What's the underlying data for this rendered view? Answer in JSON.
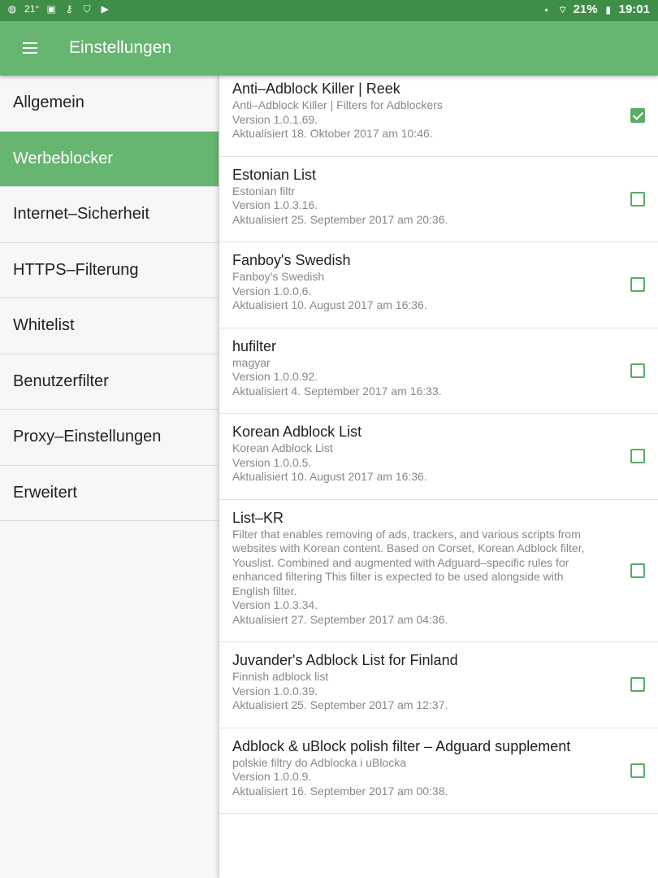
{
  "statusbar": {
    "temperature": "21°",
    "battery": "21%",
    "time": "19:01"
  },
  "appbar": {
    "title": "Einstellungen"
  },
  "sidebar": {
    "items": [
      {
        "label": "Allgemein",
        "active": false
      },
      {
        "label": "Werbeblocker",
        "active": true
      },
      {
        "label": "Internet–Sicherheit",
        "active": false
      },
      {
        "label": "HTTPS–Filterung",
        "active": false
      },
      {
        "label": "Whitelist",
        "active": false
      },
      {
        "label": "Benutzerfilter",
        "active": false
      },
      {
        "label": "Proxy–Einstellungen",
        "active": false
      },
      {
        "label": "Erweitert",
        "active": false
      }
    ]
  },
  "filters": [
    {
      "name": "Anti–Adblock Killer | Reek",
      "description": "Anti–Adblock Killer | Filters for Adblockers",
      "version": "Version 1.0.1.69.",
      "updated": "Aktualisiert 18. Oktober 2017 am 10:46.",
      "checked": true
    },
    {
      "name": "Estonian List",
      "description": "Estonian filtr",
      "version": "Version 1.0.3.16.",
      "updated": "Aktualisiert 25. September 2017 am 20:36.",
      "checked": false
    },
    {
      "name": "Fanboy's Swedish",
      "description": "Fanboy's Swedish",
      "version": "Version 1.0.0.6.",
      "updated": "Aktualisiert 10. August 2017 am 16:36.",
      "checked": false
    },
    {
      "name": "hufilter",
      "description": "magyar",
      "version": "Version 1.0.0.92.",
      "updated": "Aktualisiert 4. September 2017 am 16:33.",
      "checked": false
    },
    {
      "name": "Korean Adblock List",
      "description": "Korean Adblock List",
      "version": "Version 1.0.0.5.",
      "updated": "Aktualisiert 10. August 2017 am 16:36.",
      "checked": false
    },
    {
      "name": "List–KR",
      "description": "Filter that enables removing of ads, trackers, and various scripts from websites with Korean content. Based on Corset, Korean Adblock filter, Youslist. Combined and augmented with Adguard–specific rules for enhanced filtering This filter is expected to be used alongside with English filter.",
      "version": "Version 1.0.3.34.",
      "updated": "Aktualisiert 27. September 2017 am 04:36.",
      "checked": false
    },
    {
      "name": "Juvander's Adblock List for Finland",
      "description": "Finnish adblock list",
      "version": "Version 1.0.0.39.",
      "updated": "Aktualisiert 25. September 2017 am 12:37.",
      "checked": false
    },
    {
      "name": "Adblock & uBlock polish filter – Adguard supplement",
      "description": "polskie filtry do Adblocka i uBlocka",
      "version": "Version 1.0.0.9.",
      "updated": "Aktualisiert 16. September 2017 am 00:38.",
      "checked": false
    }
  ]
}
